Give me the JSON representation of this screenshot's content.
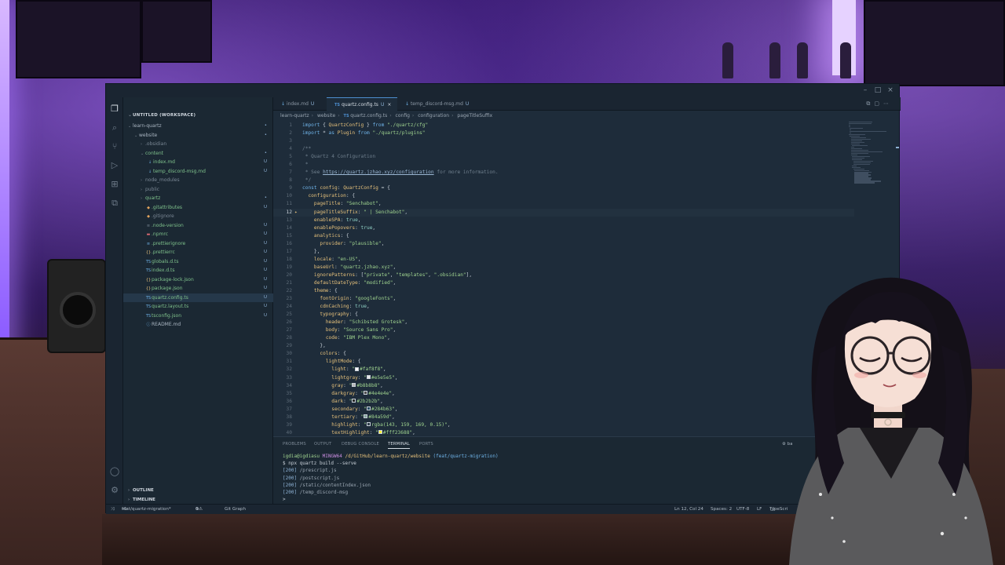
{
  "explorer": {
    "workspace_title": "UNTITLED (WORKSPACE)",
    "items": [
      {
        "label": "learn-quartz",
        "badge": "•"
      },
      {
        "label": "website",
        "badge": "•"
      },
      {
        "label": ".obsidian",
        "badge": ""
      },
      {
        "label": "content",
        "badge": "•"
      },
      {
        "label": "index.md",
        "badge": "U"
      },
      {
        "label": "temp_discord-msg.md",
        "badge": "U"
      },
      {
        "label": "node_modules",
        "badge": ""
      },
      {
        "label": "public",
        "badge": ""
      },
      {
        "label": "quartz",
        "badge": "•"
      },
      {
        "label": ".gitattributes",
        "badge": "U"
      },
      {
        "label": ".gitignore",
        "badge": ""
      },
      {
        "label": ".node-version",
        "badge": "U"
      },
      {
        "label": ".npmrc",
        "badge": "U"
      },
      {
        "label": ".prettierignore",
        "badge": "U"
      },
      {
        "label": ".prettierrc",
        "badge": "U"
      },
      {
        "label": "globals.d.ts",
        "badge": "U"
      },
      {
        "label": "index.d.ts",
        "badge": "U"
      },
      {
        "label": "package-lock.json",
        "badge": "U"
      },
      {
        "label": "package.json",
        "badge": "U"
      },
      {
        "label": "quartz.config.ts",
        "badge": "U"
      },
      {
        "label": "quartz.layout.ts",
        "badge": "U"
      },
      {
        "label": "tsconfig.json",
        "badge": "U"
      },
      {
        "label": "README.md",
        "badge": ""
      }
    ],
    "outline_label": "OUTLINE",
    "timeline_label": "TIMELINE"
  },
  "tabs": [
    {
      "label": "index.md",
      "badge": "U"
    },
    {
      "label": "quartz.config.ts",
      "badge": "U"
    },
    {
      "label": "temp_discord-msg.md",
      "badge": "U"
    }
  ],
  "breadcrumb": [
    "learn-quartz",
    "website",
    "quartz.config.ts",
    "config",
    "configuration",
    "pageTitleSuffix"
  ],
  "code_lines": [
    "import { QuartzConfig } from \"./quartz/cfg\"",
    "import * as Plugin from \"./quartz/plugins\"",
    "",
    "/**",
    " * Quartz 4 Configuration",
    " *",
    " * See https://quartz.jzhao.xyz/configuration for more information.",
    " */",
    "const config: QuartzConfig = {",
    "  configuration: {",
    "    pageTitle: \"Senchabot\",",
    "    pageTitleSuffix: \" | Senchabot\",",
    "    enableSPA: true,",
    "    enablePopovers: true,",
    "    analytics: {",
    "      provider: \"plausible\",",
    "    },",
    "    locale: \"en-US\",",
    "    baseUrl: \"quartz.jzhao.xyz\",",
    "    ignorePatterns: [\"private\", \"templates\", \".obsidian\"],",
    "    defaultDateType: \"modified\",",
    "    theme: {",
    "      fontOrigin: \"googleFonts\",",
    "      cdnCaching: true,",
    "      typography: {",
    "        header: \"Schibsted Grotesk\",",
    "        body: \"Source Sans Pro\",",
    "        code: \"IBM Plex Mono\",",
    "      },",
    "      colors: {",
    "        lightMode: {",
    "          light: \"#faf8f8\",",
    "          lightgray: \"#e5e5e5\",",
    "          gray: \"#b8b8b8\",",
    "          darkgray: \"#4e4e4e\",",
    "          dark: \"#2b2b2b\",",
    "          secondary: \"#284b63\",",
    "          tertiary: \"#84a59d\",",
    "          highlight: \"rgba(143, 159, 169, 0.15)\",",
    "          textHighlight: \"#fff23688\","
  ],
  "current_line": 12,
  "swatches": {
    "light": "#faf8f8",
    "lightgray": "#e5e5e5",
    "gray": "#b8b8b8",
    "darkgray": "#4e4e4e",
    "dark": "#2b2b2b",
    "secondary": "#284b63",
    "tertiary": "#84a59d",
    "highlight": "rgba(143, 159, 169, 0.15)",
    "textHighlight": "#fff23688"
  },
  "panel": {
    "tabs": [
      "PROBLEMS",
      "OUTPUT",
      "DEBUG CONSOLE",
      "TERMINAL",
      "PORTS"
    ],
    "active_tab": "TERMINAL",
    "terminal_lines": [
      "igdia@igdiasu MINGW64 /d/GitHub/learn-quartz/website (feat/quartz-migration)",
      "$ npx quartz build --serve",
      "[200] /prescript.js",
      "[200] /postscript.js",
      "[200] /static/contentIndex.json",
      "[200] /temp_discord-msg",
      ">"
    ],
    "shell_label": "ba"
  },
  "status": {
    "branch": "feat/quartz-migration*",
    "errors": "0",
    "warnings": "0",
    "git_graph": "Git Graph",
    "position": "Ln 12, Col 24",
    "spaces": "Spaces: 2",
    "encoding": "UTF-8",
    "eol": "LF",
    "language": "TypeScri"
  },
  "colors": {
    "accent": "#4d8fd0",
    "untracked": "#8fb3d6",
    "string": "#9fd38f",
    "keyword": "#6fb3e8",
    "property": "#e5c07b"
  }
}
